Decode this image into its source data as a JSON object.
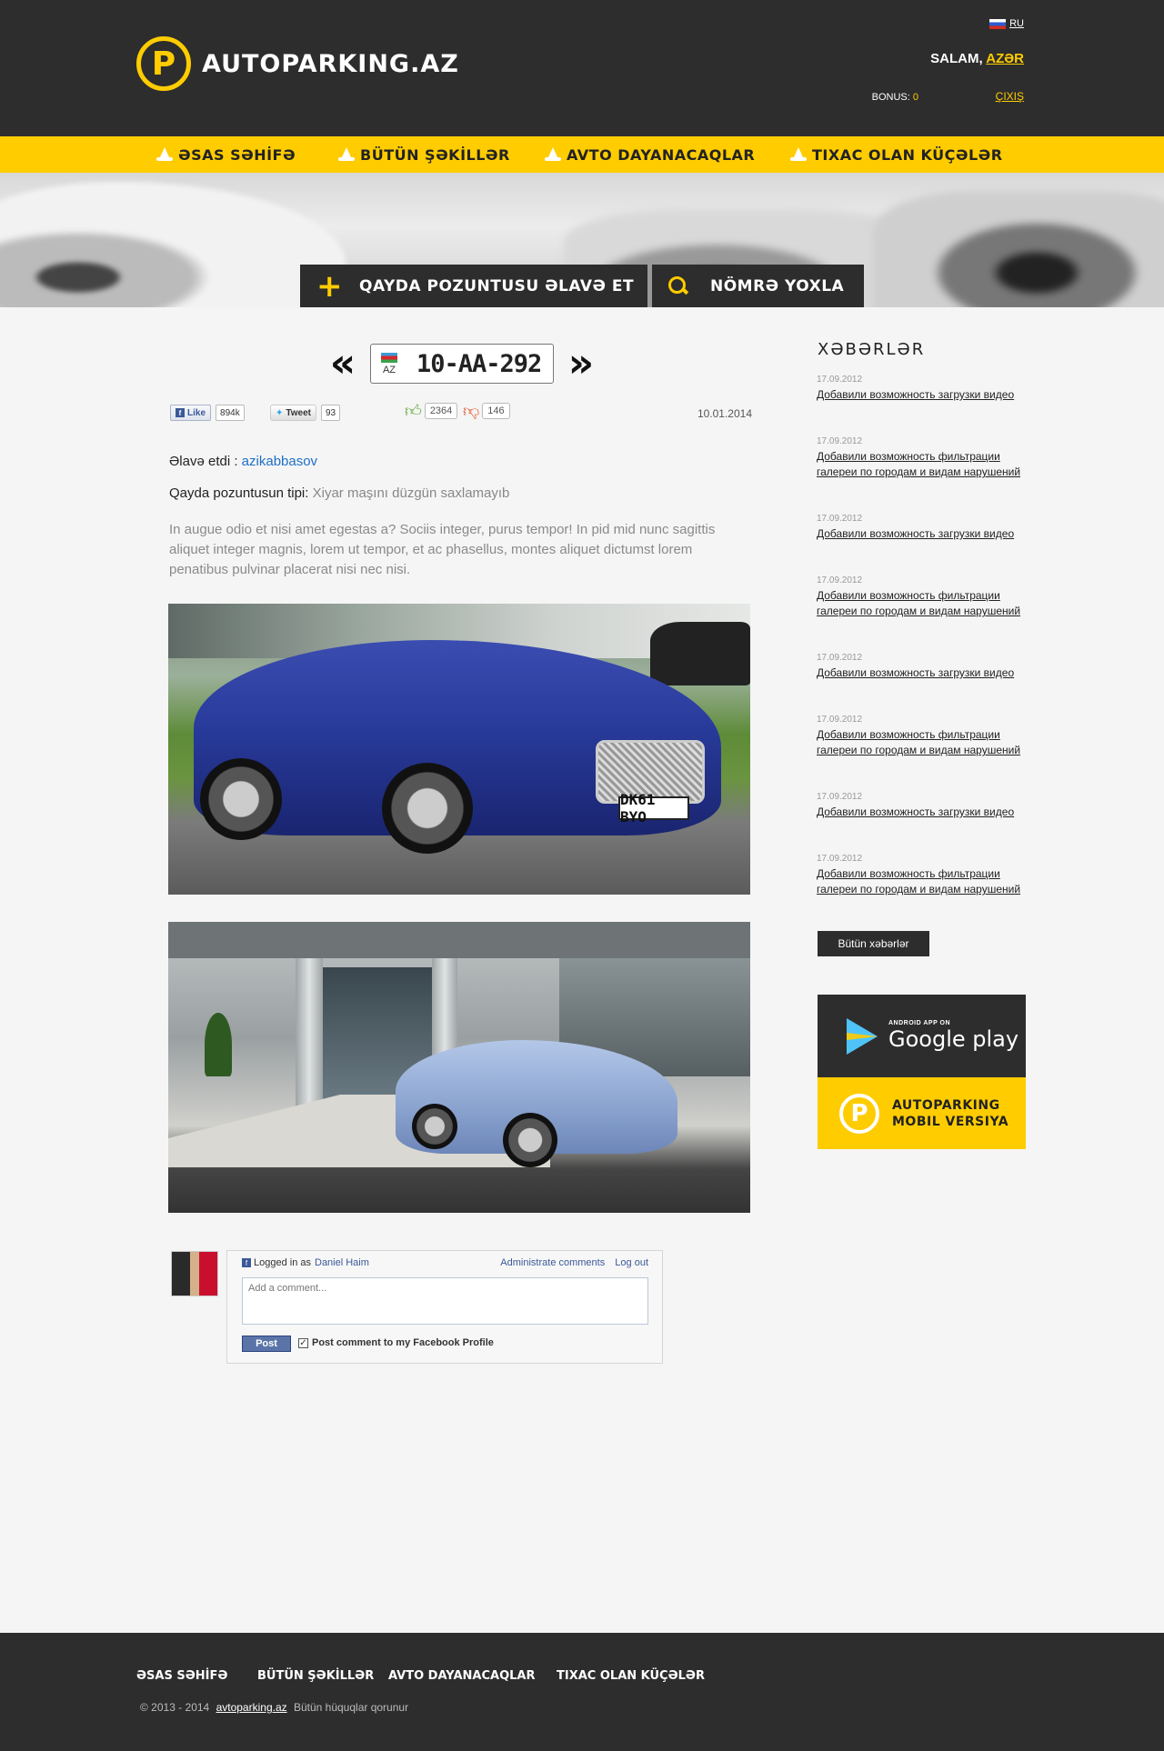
{
  "header": {
    "logo_letter": "P",
    "logo_text": "AUTOPARKING.AZ",
    "lang": "RU",
    "greeting": "SALAM,",
    "username": "AZƏR",
    "bonus_label": "BONUS:",
    "bonus_value": "0",
    "logout": "ÇIXIŞ"
  },
  "nav": [
    {
      "label": "ƏSAS SƏHİFƏ"
    },
    {
      "label": "BÜTÜN ŞƏKİLLƏR"
    },
    {
      "label": "AVTO DAYANACAQLAR"
    },
    {
      "label": "TIXAC OLAN KÜÇƏLƏR"
    }
  ],
  "banner": {
    "add_violation": "QAYDA POZUNTUSU ƏLAVƏ ET",
    "check_number": "NÖMRƏ YOXLA"
  },
  "plate": {
    "country": "AZ",
    "number": "10-AA-292",
    "prev": "«",
    "next": "»"
  },
  "social": {
    "like_label": "Like",
    "like_count": "894k",
    "tweet_label": "Tweet",
    "tweet_count": "93",
    "thumbs_up": "2364",
    "thumbs_down": "146",
    "date": "10.01.2014"
  },
  "post": {
    "added_by_label": "Əlavə etdi :",
    "added_by_user": "azikabbasov",
    "type_label": "Qayda pozuntusun tipi:",
    "type_value": "Xiyar maşını düzgün saxlamayıb",
    "description": "In augue odio et nisi amet egestas a? Sociis integer, purus tempor! In pid mid nunc sagittis aliquet integer magnis, lorem ut tempor, et ac phasellus, montes aliquet dictumst lorem penatibus pulvinar placerat nisi nec nisi.",
    "photo1_plate": "DK61 BYO"
  },
  "comments": {
    "logged_in_as": "Logged in as",
    "user_name": "Daniel Haim",
    "administrate": "Administrate comments",
    "logout": "Log out",
    "placeholder": "Add a comment...",
    "post_button": "Post",
    "post_to_profile": "Post comment to my Facebook Profile"
  },
  "sidebar": {
    "news_title": "XƏBƏRLƏR",
    "news": [
      {
        "date": "17.09.2012",
        "text": "Добавили возможность загрузки видео"
      },
      {
        "date": "17.09.2012",
        "text": "Добавили возможность фильтрации галереи по городам и видам нарушений"
      },
      {
        "date": "17.09.2012",
        "text": "Добавили возможность загрузки видео"
      },
      {
        "date": "17.09.2012",
        "text": "Добавили возможность фильтрации галереи по городам и видам нарушений"
      },
      {
        "date": "17.09.2012",
        "text": "Добавили возможность загрузки видео"
      },
      {
        "date": "17.09.2012",
        "text": "Добавили возможность фильтрации галереи по городам и видам нарушений"
      },
      {
        "date": "17.09.2012",
        "text": "Добавили возможность загрузки видео"
      },
      {
        "date": "17.09.2012",
        "text": "Добавили возможность фильтрации галереи по городам и видам нарушений"
      }
    ],
    "all_news": "Bütün xəbərlər",
    "gp_small": "ANDROID APP ON",
    "gp_big": "Google play",
    "mobile_line1": "AUTOPARKING",
    "mobile_line2": "MOBIL VERSIYA"
  },
  "footer": {
    "nav": [
      {
        "label": "ƏSAS SƏHİFƏ"
      },
      {
        "label": "BÜTÜN ŞƏKİLLƏR"
      },
      {
        "label": "AVTO DAYANACAQLAR"
      },
      {
        "label": "TIXAC OLAN KÜÇƏLƏR"
      }
    ],
    "copyright": "© 2013 - 2014",
    "site": "avtoparking.az",
    "rights": "Bütün hüquqlar qorunur"
  },
  "colors": {
    "brand_yellow": "#ffcc00",
    "dark": "#2d2d2d",
    "link_blue": "#1e6fc7"
  }
}
